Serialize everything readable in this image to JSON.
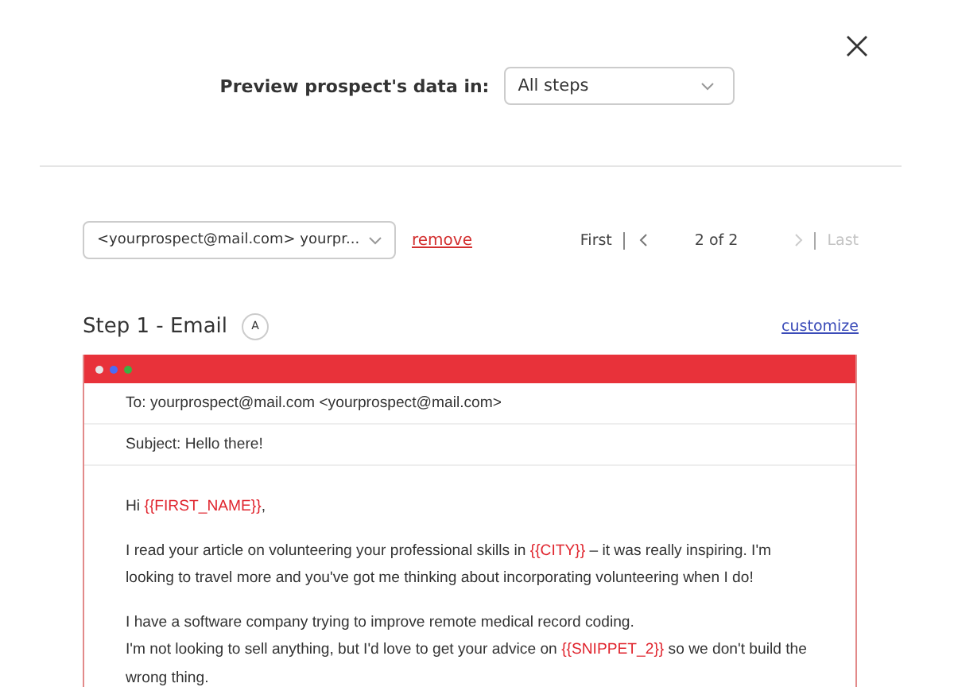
{
  "header": {
    "label": "Preview prospect's data in:",
    "select": {
      "value": "All steps"
    }
  },
  "recipient": {
    "value": "<yourprospect@mail.com> yourpr...",
    "remove": "remove"
  },
  "pager": [
    {
      "kind": "text",
      "label": "First",
      "disabled": false
    },
    {
      "kind": "prev",
      "disabled": false
    },
    {
      "kind": "count",
      "label": "2 of 2"
    },
    {
      "kind": "next",
      "disabled": true
    },
    {
      "kind": "text",
      "label": "Last",
      "disabled": true
    }
  ],
  "step": {
    "title": "Step 1 - Email",
    "badge": "A",
    "customize": "customize"
  },
  "email": {
    "dots": [
      {
        "color": "#e6e6e6"
      },
      {
        "color": "#4a6cf7"
      },
      {
        "color": "#3cb043"
      }
    ],
    "to": "To: yourprospect@mail.com <yourprospect@mail.com>",
    "subject": "Subject: Hello there!",
    "paragraphs": [
      {
        "lines": [
          [
            {
              "kind": "plain",
              "text": "Hi "
            },
            {
              "kind": "variable",
              "text": "{{FIRST_NAME}}"
            },
            {
              "kind": "plain",
              "text": ","
            }
          ]
        ]
      },
      {
        "lines": [
          [
            {
              "kind": "plain",
              "text": "I read your article on volunteering your professional skills in "
            },
            {
              "kind": "variable",
              "text": "{{CITY}}"
            },
            {
              "kind": "plain",
              "text": " – it was really inspiring. I'm looking to travel more and you've got me thinking about incorporating volunteering when I do!"
            }
          ]
        ]
      },
      {
        "lines": [
          [
            {
              "kind": "plain",
              "text": "I have a software company trying to improve remote medical record coding."
            }
          ],
          [
            {
              "kind": "plain",
              "text": "I'm not looking to sell anything, but I'd love to get your advice on "
            },
            {
              "kind": "variable",
              "text": "{{SNIPPET_2}}"
            },
            {
              "kind": "plain",
              "text": " so we don't build the wrong thing."
            }
          ]
        ]
      }
    ]
  }
}
